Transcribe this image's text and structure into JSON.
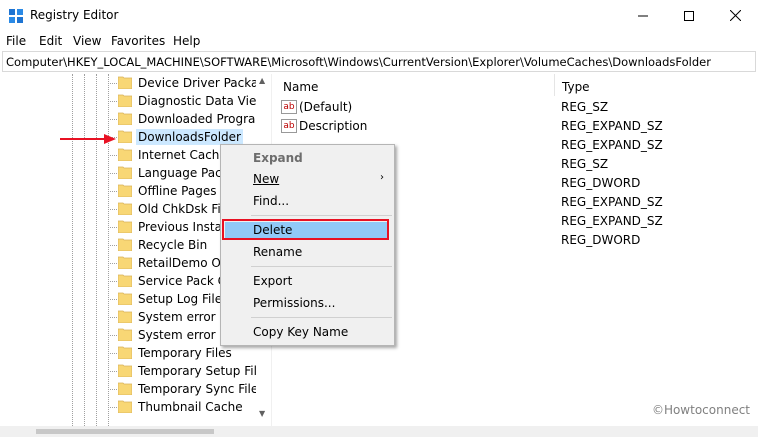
{
  "window": {
    "title": "Registry Editor",
    "icon": "registry-editor-icon"
  },
  "menu": [
    "File",
    "Edit",
    "View",
    "Favorites",
    "Help"
  ],
  "address": "Computer\\HKEY_LOCAL_MACHINE\\SOFTWARE\\Microsoft\\Windows\\CurrentVersion\\Explorer\\VolumeCaches\\DownloadsFolder",
  "tree": {
    "items": [
      "Device Driver Package",
      "Diagnostic Data Viewe",
      "Downloaded Program",
      "DownloadsFolder",
      "Internet Cache",
      "Language Pack",
      "Offline Pages F",
      "Old ChkDsk File",
      "Previous Install",
      "Recycle Bin",
      "RetailDemo Off",
      "Service Pack Cl",
      "Setup Log Files",
      "System error m",
      "System error m",
      "Temporary Files",
      "Temporary Setup Files",
      "Temporary Sync Files",
      "Thumbnail Cache"
    ],
    "selected_index": 3
  },
  "list": {
    "headers": {
      "name": "Name",
      "type": "Type"
    },
    "rows": [
      {
        "name": "(Default)",
        "type": "REG_SZ"
      },
      {
        "name": "Description",
        "type": "REG_EXPAND_SZ"
      },
      {
        "name": "",
        "type": "REG_EXPAND_SZ"
      },
      {
        "name": "",
        "type": "REG_SZ"
      },
      {
        "name": "",
        "type": "REG_DWORD"
      },
      {
        "name": "",
        "type": "REG_EXPAND_SZ"
      },
      {
        "name": "",
        "type": "REG_EXPAND_SZ"
      },
      {
        "name": "",
        "type": "REG_DWORD"
      }
    ]
  },
  "context_menu": {
    "expand": "Expand",
    "new": "New",
    "find": "Find...",
    "delete": "Delete",
    "rename": "Rename",
    "export": "Export",
    "permissions": "Permissions...",
    "copy_key_name": "Copy Key Name"
  },
  "watermark": "©Howtoconnect",
  "colors": {
    "highlight": "#91c9f7",
    "selection": "#cce8ff",
    "annotation_red": "#e81123",
    "folder_yellow": "#f8d775"
  }
}
